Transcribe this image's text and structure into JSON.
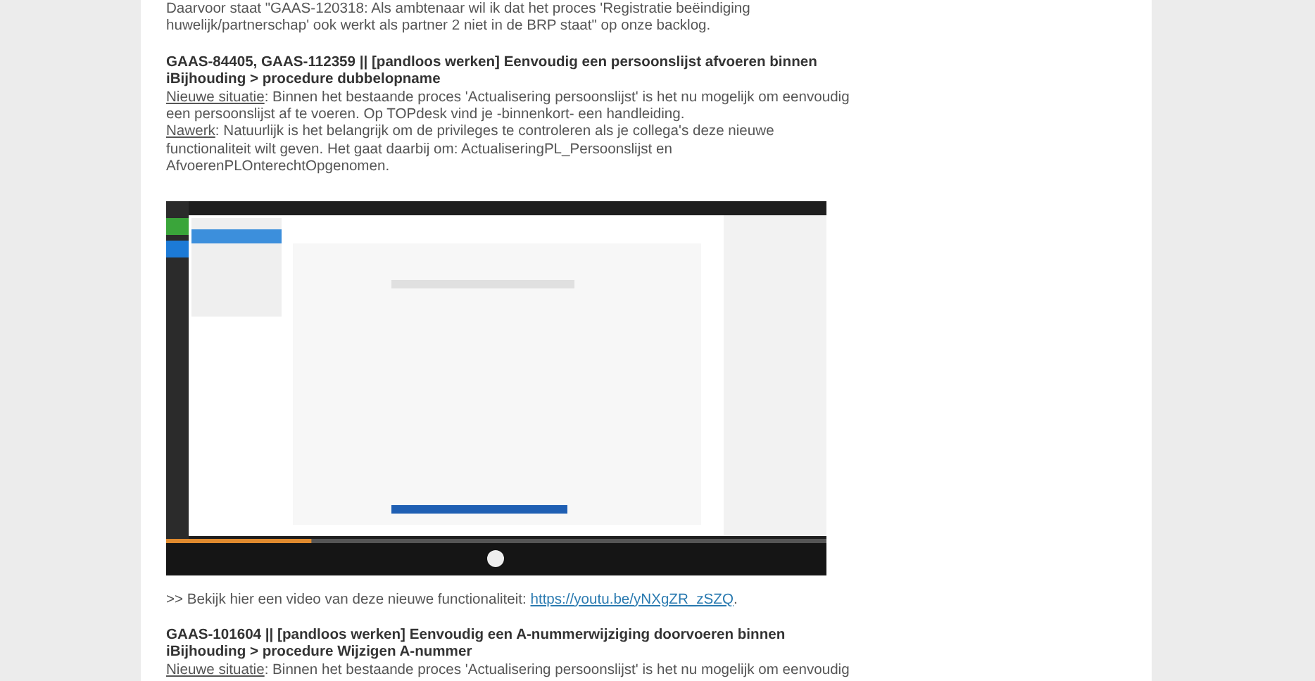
{
  "intro": "Daarvoor staat \"GAAS-120318: Als ambtenaar wil ik dat het proces 'Registratie beëindiging huwelijk/partnerschap' ook werkt als partner 2 niet in de BRP staat\" op onze backlog.",
  "sections": [
    {
      "title": "GAAS-84405, GAAS-112359 || [pandloos werken] Eenvoudig een persoonslijst afvoeren binnen iBijhouding > procedure dubbelopname",
      "notes": [
        {
          "label": "Nieuwe situatie",
          "text": ": Binnen het bestaande proces 'Actualisering persoonslijst' is het nu mogelijk om eenvoudig een persoonslijst af te voeren. Op TOPdesk vind je -binnenkort- een handleiding."
        },
        {
          "label": "Nawerk",
          "text": ": Natuurlijk is het belangrijk om de privileges te controleren als je collega's deze nieuwe functionaliteit wilt geven. Het gaat daarbij om: ActualiseringPL_Persoonslijst en AfvoerenPLOnterechtOpgenomen."
        }
      ],
      "video": {
        "kind": "picture",
        "progress": {
          "level": 0.22
        },
        "caption": ">> Bekijk hier een video van deze nieuwe functionaliteit: ",
        "link": "https://youtu.be/yNXgZR_zSZQ",
        "after": "."
      }
    },
    {
      "title": "GAAS-101604 || [pandloos werken] Eenvoudig een A-nummerwijziging doorvoeren binnen iBijhouding > procedure Wijzigen A-nummer",
      "notes": [
        {
          "label": "Nieuwe situatie",
          "text": ": Binnen het bestaande proces 'Actualisering persoonslijst' is het nu mogelijk om eenvoudig"
        }
      ]
    }
  ]
}
